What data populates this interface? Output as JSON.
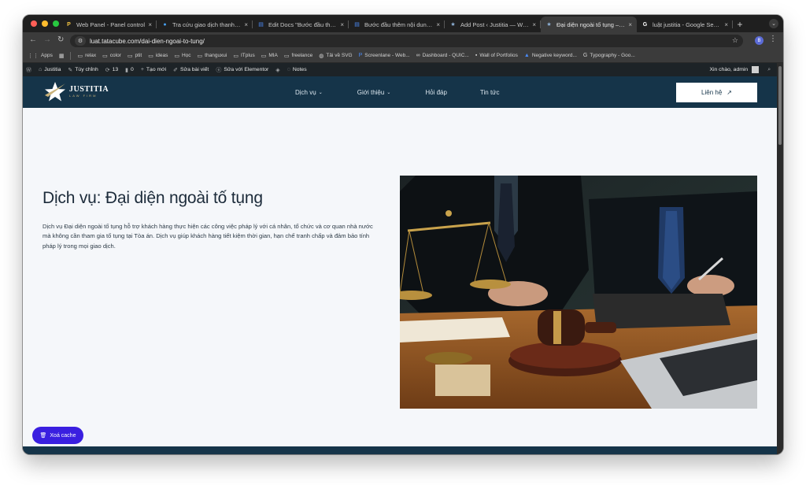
{
  "browser": {
    "tabs": [
      {
        "title": "Web Panel - Panel control",
        "favicon": "panel-icon",
        "color": "#f5c542"
      },
      {
        "title": "Tra cứu giao dịch thanh toán",
        "favicon": "pin-icon",
        "color": "#46a0f0"
      },
      {
        "title": "Edit Docs \"Bước đầu thêm nội dung\"",
        "favicon": "docs-icon",
        "color": "#4a8af4"
      },
      {
        "title": "Bước đầu thêm nội dung – Ta",
        "favicon": "docs-icon",
        "color": "#4a8af4"
      },
      {
        "title": "Add Post ‹ Justitia — WordPress",
        "favicon": "star-icon",
        "color": "#8fb3d9"
      },
      {
        "title": "Đại diện ngoài tố tụng – Justitia",
        "favicon": "star-icon",
        "color": "#8fb3d9",
        "active": true
      },
      {
        "title": "luật justitia - Google Search",
        "favicon": "google-icon",
        "color": "#ffffff"
      }
    ],
    "url": "luat.tatacube.com/dai-dien-ngoai-to-tung/",
    "bookmarks": [
      {
        "label": "Apps",
        "icon": "apps-icon"
      },
      {
        "label": "",
        "icon": "grid-icon"
      },
      {
        "label": "relax",
        "icon": "folder-icon"
      },
      {
        "label": "color",
        "icon": "folder-icon"
      },
      {
        "label": "ptit",
        "icon": "folder-icon"
      },
      {
        "label": "ideas",
        "icon": "folder-icon"
      },
      {
        "label": "Học",
        "icon": "folder-icon"
      },
      {
        "label": "thanguxui",
        "icon": "folder-icon"
      },
      {
        "label": "ITplus",
        "icon": "folder-icon"
      },
      {
        "label": "MIA",
        "icon": "folder-icon"
      },
      {
        "label": "freelance",
        "icon": "folder-icon"
      },
      {
        "label": "Tải về SVG",
        "icon": "globe-icon"
      },
      {
        "label": "Screenlane - Web...",
        "icon": "p-icon"
      },
      {
        "label": "Dashboard - QUIC...",
        "icon": "link-icon"
      },
      {
        "label": "Wall of Portfolios",
        "icon": "wall-icon"
      },
      {
        "label": "Negative keyword...",
        "icon": "ads-icon"
      },
      {
        "label": "Typography - Goo...",
        "icon": "g-icon"
      }
    ]
  },
  "adminbar": {
    "items": [
      {
        "label": "",
        "icon": "wordpress-icon"
      },
      {
        "label": "Justitia",
        "icon": "home-icon"
      },
      {
        "label": "Tùy chỉnh",
        "icon": "brush-icon"
      },
      {
        "label": "13",
        "icon": "refresh-icon"
      },
      {
        "label": "0",
        "icon": "comment-icon"
      },
      {
        "label": "Tạo mới",
        "icon": "plus-icon"
      },
      {
        "label": "Sửa bài viết",
        "icon": "pencil-icon"
      },
      {
        "label": "Sửa với Elementor",
        "icon": "elementor-icon"
      },
      {
        "label": "",
        "icon": "diamond-icon"
      },
      {
        "label": "Notes",
        "icon": "notes-icon"
      }
    ],
    "greeting": "Xin chào, admin"
  },
  "site": {
    "logo_main": "JUSTITIA",
    "logo_sub": "LAW FIRM",
    "menu": [
      {
        "label": "Dịch vụ",
        "dropdown": true
      },
      {
        "label": "Giới thiệu",
        "dropdown": true
      },
      {
        "label": "Hỏi đáp",
        "dropdown": false
      },
      {
        "label": "Tin tức",
        "dropdown": false
      }
    ],
    "contact_label": "Liên hệ",
    "accent": "#153449"
  },
  "hero": {
    "title": "Dịch vụ: Đại diện ngoài tố tụng",
    "description": "Dịch vụ Đại diện ngoài tố tụng hỗ trợ khách hàng thực hiện các công việc pháp lý với cá nhân, tổ chức và cơ quan nhà nước mà không cần tham gia tố tụng tại Tòa án. Dịch vụ giúp khách hàng tiết kiệm thời gian, hạn chế tranh chấp và đảm bảo tính pháp lý trong mọi giao dịch."
  },
  "cache_button": "Xoá cache"
}
